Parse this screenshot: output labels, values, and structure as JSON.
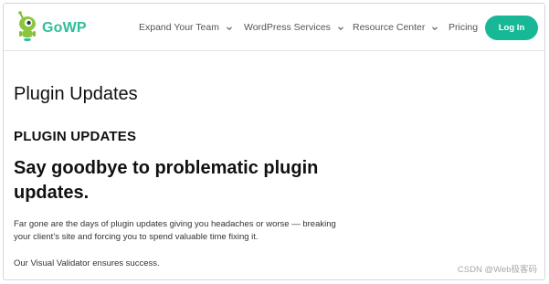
{
  "header": {
    "logo_text": "GoWP",
    "nav": [
      {
        "label": "Expand Your Team"
      },
      {
        "label": "WordPress Services"
      },
      {
        "label": "Resource Center"
      },
      {
        "label": "Pricing"
      }
    ],
    "login_label": "Log In"
  },
  "main": {
    "page_title": "Plugin Updates",
    "section_heading": "PLUGIN UPDATES",
    "headline": "Say goodbye to problematic plugin updates.",
    "paragraph_1": "Far gone are the days of plugin updates giving you headaches or worse — breaking your client’s site and forcing you to spend valuable time fixing it.",
    "paragraph_2": "Our Visual Validator ensures success."
  },
  "watermark": "CSDN @Web极客码",
  "colors": {
    "brand": "#2fbf9b",
    "button": "#18b896",
    "mascot": "#8cc63f"
  },
  "icons": {
    "logo": "robot-mascot-icon",
    "dropdown": "chevron-down-icon"
  }
}
